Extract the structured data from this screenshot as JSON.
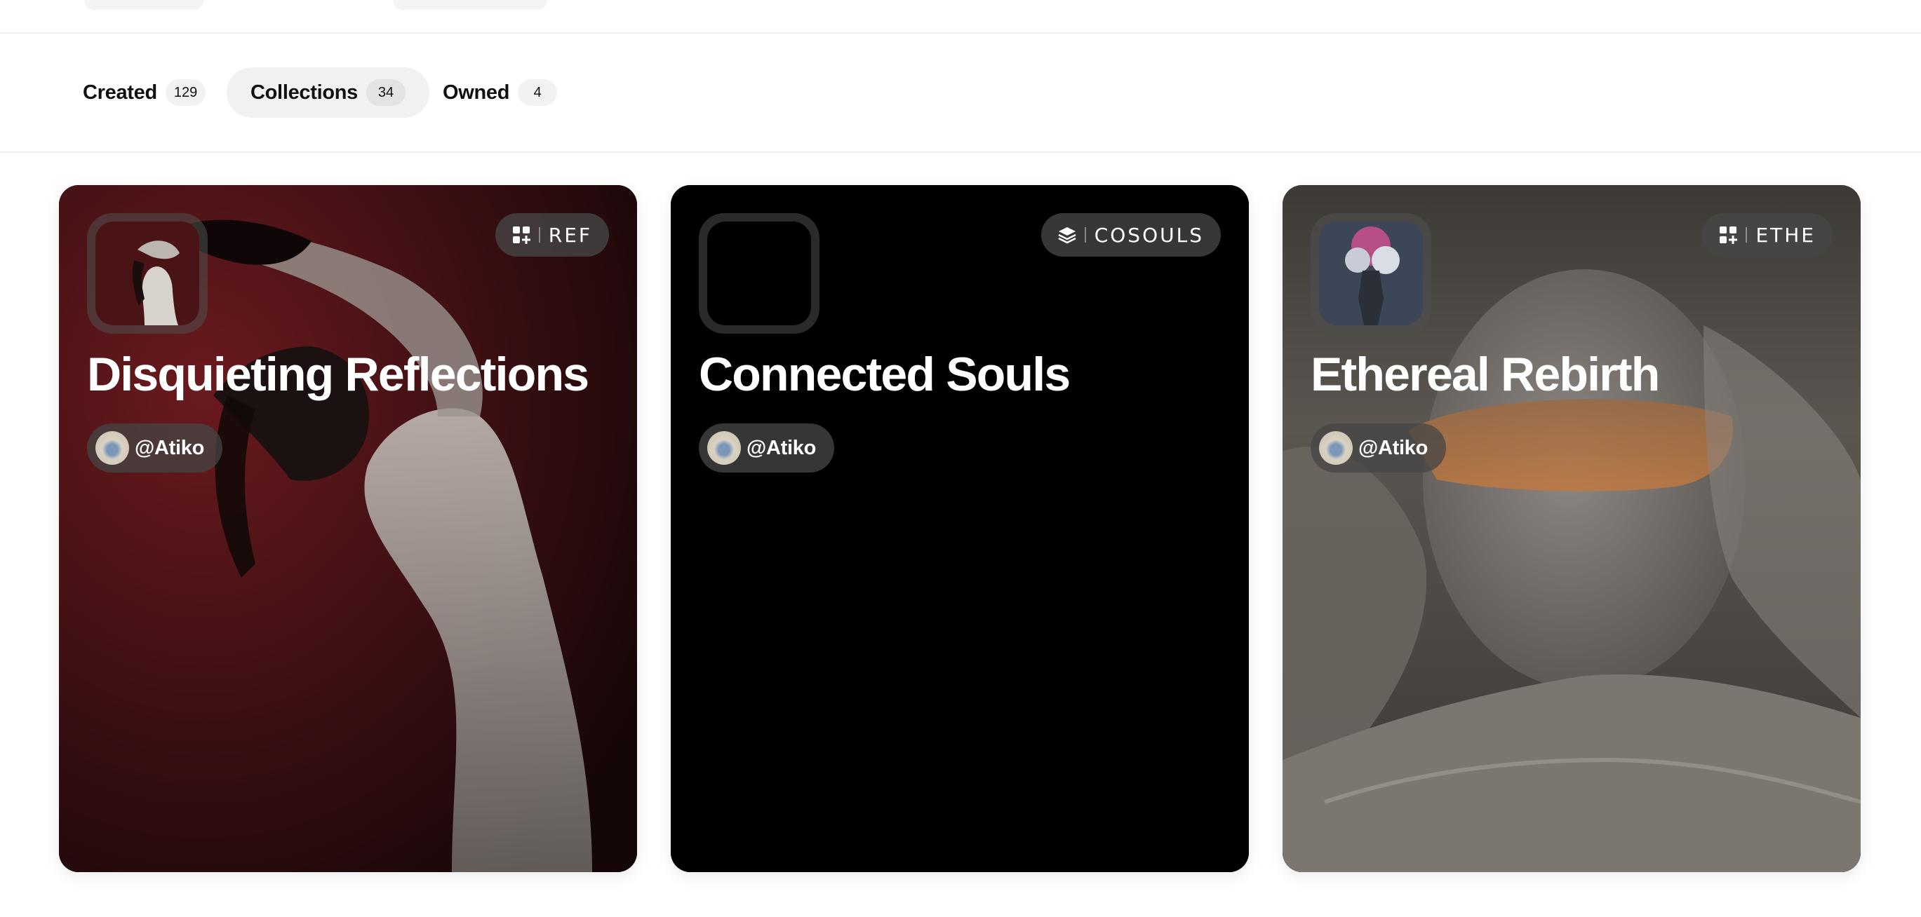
{
  "tabs": [
    {
      "label": "Created",
      "count": "129",
      "active": false
    },
    {
      "label": "Collections",
      "count": "34",
      "active": true
    },
    {
      "label": "Owned",
      "count": "4",
      "active": false
    }
  ],
  "collections": [
    {
      "title": "Disquieting Reflections",
      "badge_text": "REF",
      "badge_icon": "grid-plus-icon",
      "creator": "@Atiko"
    },
    {
      "title": "Connected Souls",
      "badge_text": "COSOULS",
      "badge_icon": "layers-icon",
      "creator": "@Atiko"
    },
    {
      "title": "Ethereal Rebirth",
      "badge_text": "ETHE",
      "badge_icon": "grid-plus-icon",
      "creator": "@Atiko"
    }
  ],
  "colors": {
    "active_tab_bg": "#f1f1f1",
    "chip_bg": "#464646",
    "text_dark": "#111111"
  }
}
